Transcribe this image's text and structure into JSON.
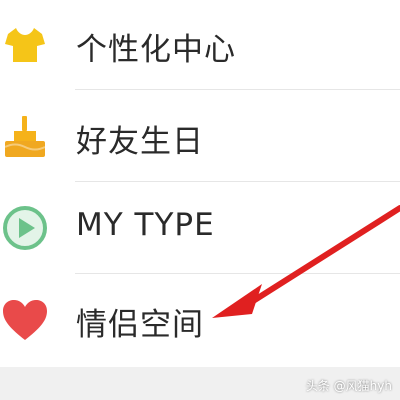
{
  "menu": {
    "items": [
      {
        "label": "个性化中心",
        "icon": "tshirt-icon",
        "icon_color": "#f5c518"
      },
      {
        "label": "好友生日",
        "icon": "birthday-cake-icon",
        "icon_color": "#f5b21a"
      },
      {
        "label": "MY TYPE",
        "icon": "play-circle-icon",
        "icon_color": "#6cc28a"
      },
      {
        "label": "情侣空间",
        "icon": "heart-icon",
        "icon_color": "#e94a4a"
      }
    ]
  },
  "annotation": {
    "arrow_color": "#e02020"
  },
  "watermark": {
    "text": "头条 @风猫hyh"
  }
}
